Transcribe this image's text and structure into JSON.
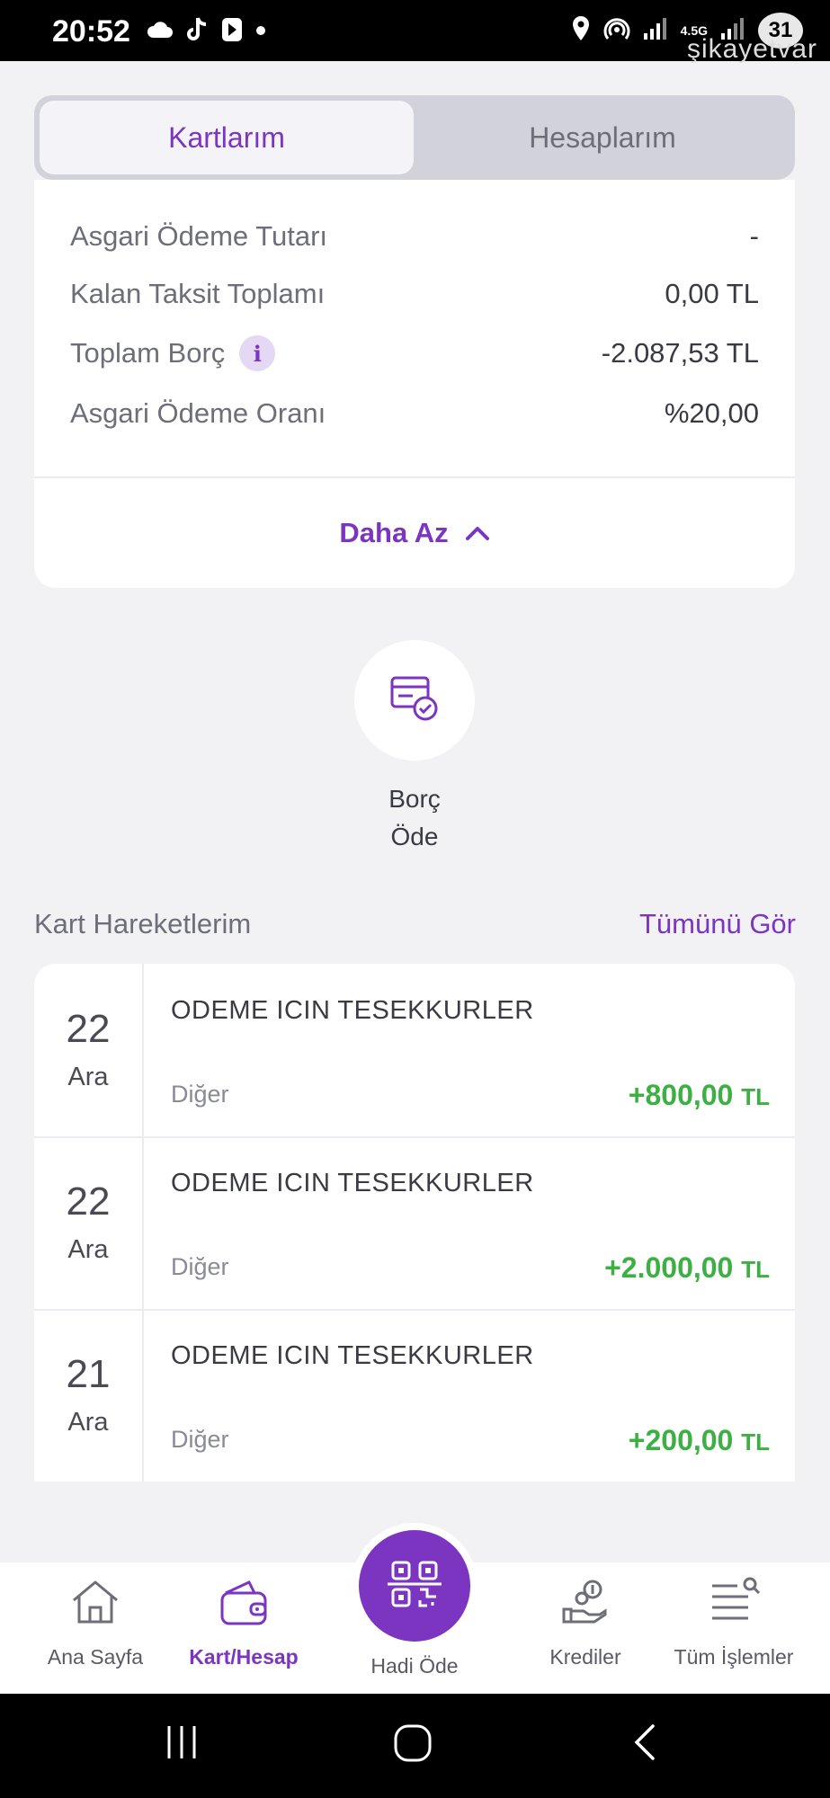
{
  "status_bar": {
    "time": "20:52",
    "network": "4.5G",
    "battery": "31",
    "watermark": "şikayetvar"
  },
  "tabs": [
    {
      "label": "Kartlarım",
      "active": true
    },
    {
      "label": "Hesaplarım",
      "active": false
    }
  ],
  "details": {
    "rows": [
      {
        "label": "Asgari Ödeme Tutarı",
        "value": "-"
      },
      {
        "label": "Kalan Taksit Toplamı",
        "value": "0,00 TL"
      },
      {
        "label": "Toplam Borç",
        "value": "-2.087,53 TL",
        "info_icon": "info-icon"
      },
      {
        "label": "Asgari Ödeme Oranı",
        "value": "%20,00"
      }
    ],
    "less_label": "Daha Az"
  },
  "pay_debt": {
    "label_line1": "Borç",
    "label_line2": "Öde",
    "icon": "card-check-icon"
  },
  "transactions": {
    "title": "Kart Hareketlerim",
    "see_all": "Tümünü Gör",
    "items": [
      {
        "day": "22",
        "month": "Ara",
        "description": "ODEME ICIN TESEKKURLER",
        "category": "Diğer",
        "amount": "+800,00",
        "currency": "TL"
      },
      {
        "day": "22",
        "month": "Ara",
        "description": "ODEME ICIN TESEKKURLER",
        "category": "Diğer",
        "amount": "+2.000,00",
        "currency": "TL"
      },
      {
        "day": "21",
        "month": "Ara",
        "description": "ODEME ICIN TESEKKURLER",
        "category": "Diğer",
        "amount": "+200,00",
        "currency": "TL"
      }
    ]
  },
  "bottom_nav": {
    "items": [
      {
        "label": "Ana Sayfa",
        "icon": "home-icon"
      },
      {
        "label": "Kart/Hesap",
        "icon": "wallet-icon",
        "active": true
      },
      {
        "label": "Hadi Öde",
        "icon": "qr-code-icon"
      },
      {
        "label": "Krediler",
        "icon": "loan-hand-icon"
      },
      {
        "label": "Tüm İşlemler",
        "icon": "list-search-icon"
      }
    ]
  },
  "colors": {
    "accent": "#7b35c1",
    "positive": "#3cb043",
    "background": "#f2f2f5"
  }
}
